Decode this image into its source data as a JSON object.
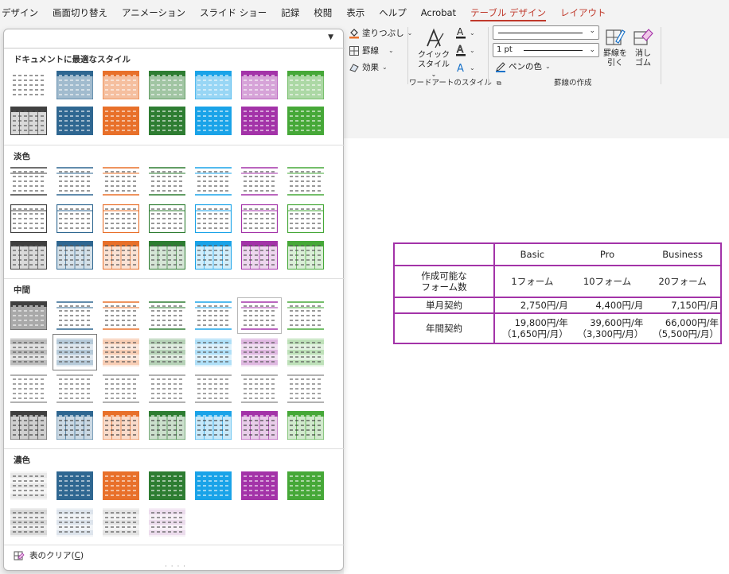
{
  "menubar": {
    "items": [
      {
        "label": "デザイン"
      },
      {
        "label": "画面切り替え"
      },
      {
        "label": "アニメーション"
      },
      {
        "label": "スライド ショー"
      },
      {
        "label": "記録"
      },
      {
        "label": "校閲"
      },
      {
        "label": "表示"
      },
      {
        "label": "ヘルプ"
      },
      {
        "label": "Acrobat"
      },
      {
        "label": "テーブル デザイン",
        "contextual": true,
        "active": true
      },
      {
        "label": "レイアウト",
        "contextual": true
      }
    ]
  },
  "ribbon": {
    "fill_label": "塗りつぶし",
    "border_label": "罫線",
    "effects_label": "効果",
    "quick_style_label_1": "クイック",
    "quick_style_label_2": "スタイル",
    "wordart_group_label": "ワードアートのスタイル",
    "pen_weight": "1 pt",
    "pen_color_label": "ペンの色",
    "draw_border_label_1": "罫線を",
    "draw_border_label_2": "引く",
    "eraser_label_1": "消し",
    "eraser_label_2": "ゴム",
    "draw_group_label": "罫線の作成"
  },
  "gallery": {
    "sections": [
      {
        "title": "ドキュメントに最適なスタイル"
      },
      {
        "title": "淡色"
      },
      {
        "title": "中間"
      },
      {
        "title": "濃色"
      }
    ],
    "clear_label": "表のクリア(",
    "clear_key": "C",
    "clear_close": ")",
    "accent_colors": [
      "#404040",
      "#2f6791",
      "#e8702a",
      "#2e7d32",
      "#1aa3e8",
      "#a333a8",
      "#46a838"
    ]
  },
  "pricing_table": {
    "headers": [
      "",
      "Basic",
      "Pro",
      "Business"
    ],
    "rows": [
      {
        "label_1": "作成可能な",
        "label_2": "フォーム数",
        "cells": [
          "1フォーム",
          "10フォーム",
          "20フォーム"
        ]
      },
      {
        "label_1": "単月契約",
        "label_2": "",
        "cells": [
          "2,750円/月",
          "4,400円/月",
          "7,150円/月"
        ]
      },
      {
        "label_1": "年間契約",
        "label_2": "",
        "cells": [
          "19,800円/年",
          "39,600円/年",
          "66,000円/年"
        ],
        "cells_2": [
          "（1,650円/月）",
          "（3,300円/月）",
          "（5,500円/月）"
        ]
      }
    ]
  }
}
